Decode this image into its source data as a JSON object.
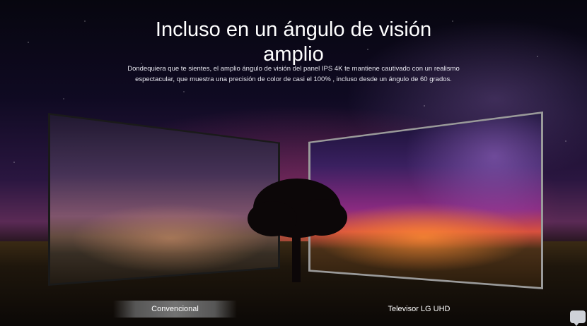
{
  "hero": {
    "headline_line1": "Incluso en un ángulo de visión",
    "headline_line2": "amplio",
    "description": "Dondequiera que te sientes, el amplio ángulo de visión del panel IPS 4K te mantiene cautivado con un realismo espectacular, que muestra una precisión de color de casi el 100% , incluso desde un ángulo de 60 grados."
  },
  "comparison": {
    "left_label": "Convencional",
    "right_label": "Televisor LG UHD"
  },
  "icons": {
    "chat": "chat-bubble-icon"
  },
  "colors": {
    "text": "#ffffff",
    "label_highlight": "#8a8a8a"
  }
}
